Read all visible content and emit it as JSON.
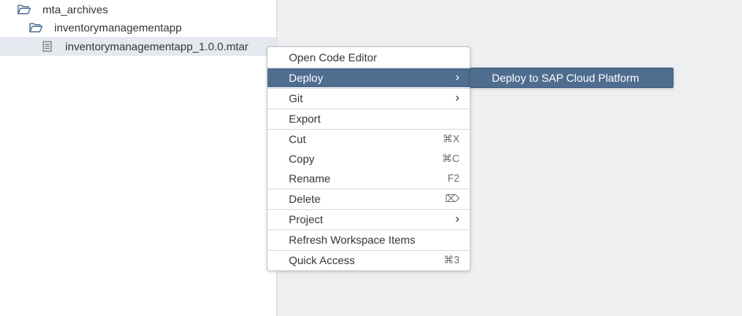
{
  "tree": {
    "items": [
      {
        "label": "mta_archives",
        "icon": "folder-open-icon"
      },
      {
        "label": "inventorymanagementapp",
        "icon": "folder-open-icon"
      },
      {
        "label": "inventorymanagementapp_1.0.0.mtar",
        "icon": "document-icon"
      }
    ]
  },
  "context_menu": {
    "items": [
      {
        "label": "Open Code Editor",
        "shortcut": ""
      },
      {
        "label": "Deploy",
        "shortcut": ""
      },
      {
        "label": "Git",
        "shortcut": ""
      },
      {
        "label": "Export",
        "shortcut": ""
      },
      {
        "label": "Cut",
        "shortcut": "⌘X"
      },
      {
        "label": "Copy",
        "shortcut": "⌘C"
      },
      {
        "label": "Rename",
        "shortcut": "F2"
      },
      {
        "label": "Delete",
        "shortcut": "⌦"
      },
      {
        "label": "Project",
        "shortcut": ""
      },
      {
        "label": "Refresh Workspace Items",
        "shortcut": ""
      },
      {
        "label": "Quick Access",
        "shortcut": "⌘3"
      }
    ]
  },
  "submenu": {
    "items": [
      {
        "label": "Deploy to SAP Cloud Platform"
      }
    ]
  },
  "colors": {
    "selection": "#4f6d8f",
    "tree_selected_row": "#e5e9ef",
    "workspace_bg": "#eeeff1"
  }
}
